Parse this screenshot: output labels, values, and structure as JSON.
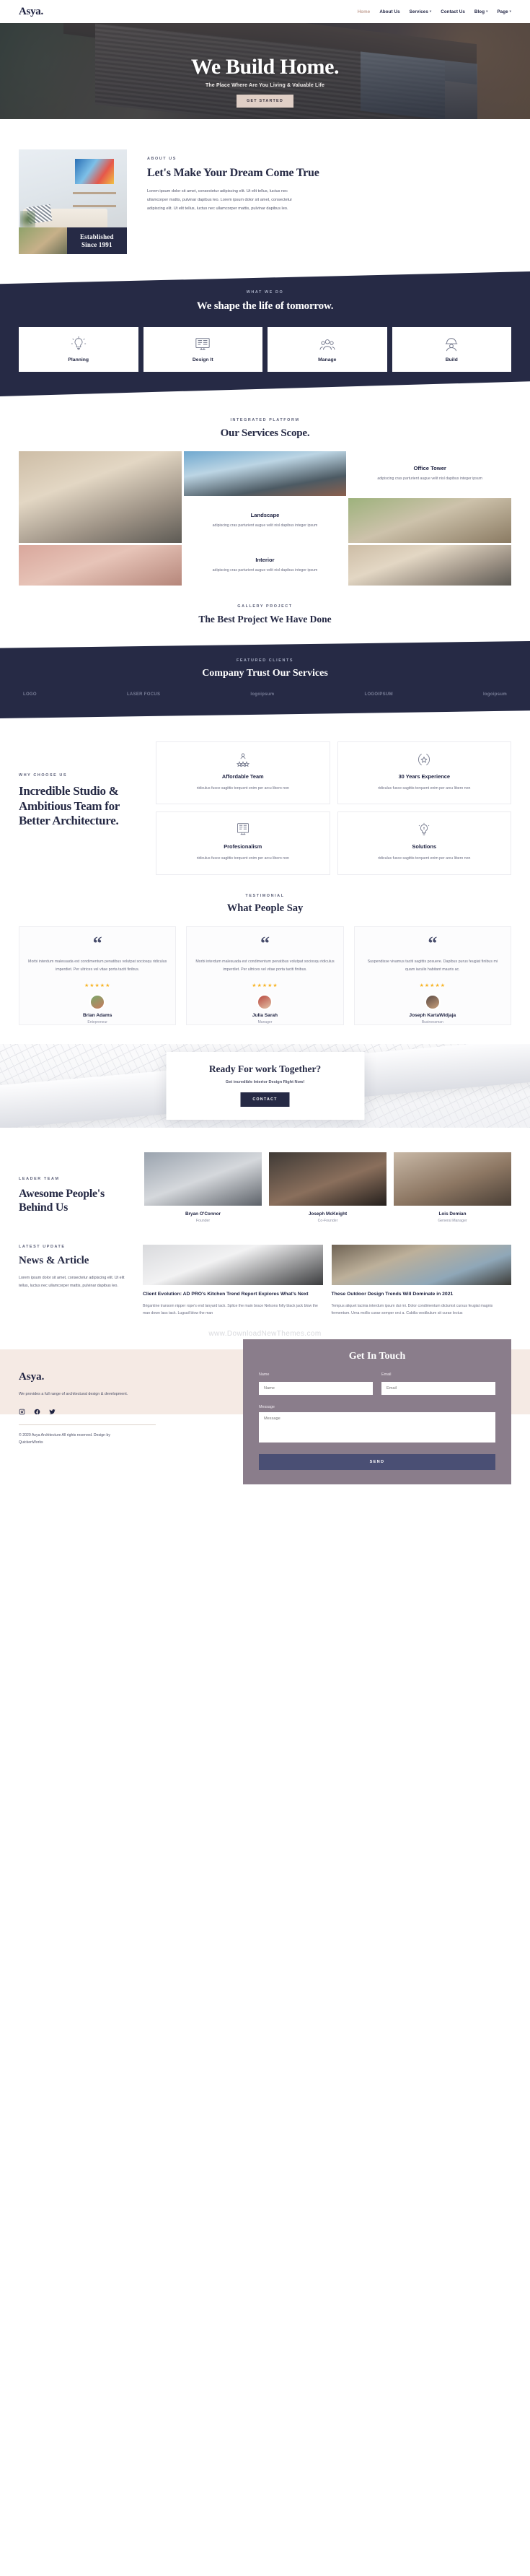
{
  "header": {
    "logo": "Asya.",
    "nav": [
      {
        "label": "Home",
        "active": true,
        "caret": false
      },
      {
        "label": "About Us",
        "active": false,
        "caret": false
      },
      {
        "label": "Services",
        "active": false,
        "caret": true
      },
      {
        "label": "Contact Us",
        "active": false,
        "caret": false
      },
      {
        "label": "Blog",
        "active": false,
        "caret": true
      },
      {
        "label": "Page",
        "active": false,
        "caret": true
      }
    ]
  },
  "hero": {
    "title": "We Build Home.",
    "subtitle": "The Place Where Are You Living & Valuable Life",
    "button": "GET STARTED"
  },
  "about": {
    "eyebrow": "ABOUT US",
    "title": "Let's Make Your Dream Come True",
    "body": "Lorem ipsum dolor sit amet, consectetur adipiscing elit. Ut elit tellus, luctus nec ullamcorper mattis, pulvinar dapibus leo. Lorem ipsum dolor sit amet, consectetur adipiscing elit. Ut elit tellus, luctus nec ullamcorper mattis, pulvinar dapibus leo.",
    "badge_line1": "Established",
    "badge_line2": "Since 1991"
  },
  "whatwedo": {
    "eyebrow": "WHAT WE DO",
    "title": "We shape the life of tomorrow.",
    "cards": [
      {
        "label": "Planning",
        "icon": "lightbulb-icon"
      },
      {
        "label": "Design It",
        "icon": "monitor-design-icon"
      },
      {
        "label": "Manage",
        "icon": "team-icon"
      },
      {
        "label": "Build",
        "icon": "worker-helmet-icon"
      }
    ]
  },
  "services": {
    "eyebrow": "INTEGRATED PLATFORM",
    "title": "Our Services Scope.",
    "cards": [
      {
        "title": "Office Tower",
        "text": "adipiscing cras parturient augue velit nisl dapibus integer ipsum"
      },
      {
        "title": "Landscape",
        "text": "adipiscing cras parturient augue velit nisl dapibus integer ipsum"
      },
      {
        "title": "Interior",
        "text": "adipiscing cras parturient augue velit nisl dapibus integer ipsum"
      }
    ]
  },
  "gallery": {
    "eyebrow": "GALLERY PROJECT",
    "title": "The Best Project We Have Done"
  },
  "clients": {
    "eyebrow": "FEATURED CLIENTS",
    "title": "Company Trust Our Services",
    "logos": [
      "LOGO",
      "LASER FOCUS",
      "logoipsum",
      "LOGOIPSUM",
      "logoipsum"
    ]
  },
  "why": {
    "eyebrow": "WHY CHOOSE US",
    "title": "Incredible Studio & Ambitious Team for Better Architecture.",
    "features": [
      {
        "title": "Affordable Team",
        "text": "ridiculus fusce sagittis torquent enim per arcu libero non",
        "icon": "team-star-icon"
      },
      {
        "title": "30 Years Experience",
        "text": "ridiculus fusce sagittis torquent enim per arcu libero non",
        "icon": "laurel-star-icon"
      },
      {
        "title": "Profesionalism",
        "text": "ridiculus fusce sagittis torquent enim per arcu libero non",
        "icon": "monitor-document-icon"
      },
      {
        "title": "Solutions",
        "text": "ridiculus fusce sagittis torquent enim per arcu libero non",
        "icon": "lightbulb-idea-icon"
      }
    ]
  },
  "testimonial": {
    "eyebrow": "TESTIMONIAL",
    "title": "What People Say",
    "items": [
      {
        "quote": "Morbi interdum malesuada est condimentum penatibus volutpat sociosqu ridiculus imperdiet. Per ultrices vel vitae porta taciti finibus.",
        "stars": "★★★★★",
        "name": "Brian Adams",
        "role": "Entepreneur"
      },
      {
        "quote": "Morbi interdum malesuada est condimentum penatibus volutpat sociosqu ridiculus imperdiet. Per ultrices vel vitae porta taciti finibus.",
        "stars": "★★★★★",
        "name": "Julia Sarah",
        "role": "Manager"
      },
      {
        "quote": "Suspendisse vivamus taciti sagittis posuere. Dapibus purus feugiat finibus mi quam iaculis habitant mauris ac.",
        "stars": "★★★★★",
        "name": "Joseph KartaWidjaja",
        "role": "Businessman"
      }
    ]
  },
  "cta": {
    "title": "Ready For work Together?",
    "subtitle": "Get incredible Interior Design Right Now!",
    "button": "CONTACT"
  },
  "team": {
    "eyebrow": "LEADER TEAM",
    "title": "Awesome People's Behind Us",
    "members": [
      {
        "name": "Bryan O'Connor",
        "role": "Founder"
      },
      {
        "name": "Joseph McKnight",
        "role": "Co-Founder"
      },
      {
        "name": "Lois Demian",
        "role": "General Manager"
      }
    ]
  },
  "news": {
    "eyebrow": "LATEST UPDATE",
    "title": "News & Article",
    "intro": "Lorem ipsum dolor sit amet, consectetur adipiscing elit. Ut elit tellus, luctus nec ullamcorper mattis, pulvinar dapibus leo.",
    "posts": [
      {
        "title": "Client Evolution: AD PRO's Kitchen Trend Report Explores What's Next",
        "excerpt": "Brigantine transom nipper rope's end lanyard tack. Splice the main brace Nelsons folly black jack blow the man down lass tack. Lugsail blow the man"
      },
      {
        "title": "These Outdoor Design Trends Will Dominate in 2021",
        "excerpt": "Tempus aliquet lacinia interdum ipsum dui mi. Dolor condimentum dictumst cursus feugiat magnis fermentum. Urna mollis curae semper orci a. Cubilia vestibulum sit curae lectus"
      }
    ],
    "watermark": "www.DownloadNewThemes.com"
  },
  "footer": {
    "logo": "Asya.",
    "description": "We provides a full range of architectural design & development.",
    "social": [
      "instagram-icon",
      "facebook-icon",
      "twitter-icon"
    ],
    "copyright": "© 2020 Asya Architecture All rights reserved. Design by QuickenWorks",
    "contact": {
      "title": "Get In Touch",
      "name_label": "Name",
      "name_placeholder": "Name",
      "email_label": "Email",
      "email_placeholder": "Email",
      "message_label": "Message",
      "message_placeholder": "Message",
      "send_label": "SEND"
    }
  },
  "colors": {
    "navy": "#262a45",
    "accent_rose": "#c3a296",
    "cta_button": "#e0cfc6",
    "footer_bg": "#f5eae4",
    "contact_bg": "#8a7d8b",
    "star": "#f7b425"
  }
}
